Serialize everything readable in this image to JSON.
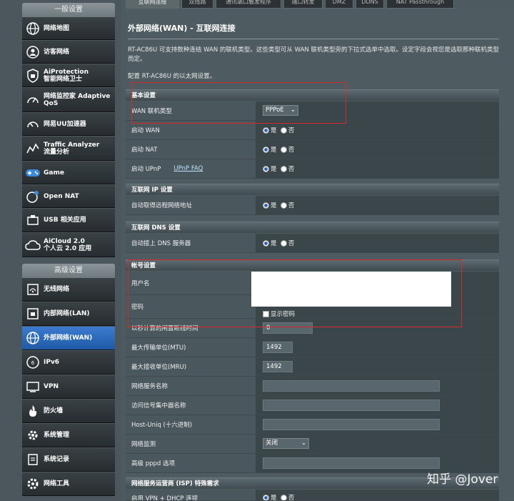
{
  "sidebar": {
    "general_header": "一般设置",
    "advanced_header": "高级设置",
    "general_items": [
      {
        "label": "网络地图",
        "icon": "globe-icon"
      },
      {
        "label": "访客网络",
        "icon": "guest-network-icon"
      },
      {
        "label": "AiProtection\n智能网络卫士",
        "icon": "shield-icon"
      },
      {
        "label": "网络监控家 Adaptive\nQoS",
        "icon": "qos-gauge-icon"
      },
      {
        "label": "网易UU加速器",
        "icon": "speedometer-icon"
      },
      {
        "label": "Traffic Analyzer\n流量分析",
        "icon": "traffic-chart-icon"
      },
      {
        "label": "Game",
        "icon": "gamepad-icon"
      },
      {
        "label": "Open NAT",
        "icon": "open-nat-icon"
      },
      {
        "label": "USB 相关应用",
        "icon": "usb-icon"
      },
      {
        "label": "AiCloud 2.0\n个人云 2.0 应用",
        "icon": "cloud-icon"
      }
    ],
    "advanced_items": [
      {
        "label": "无线网络",
        "icon": "wireless-icon"
      },
      {
        "label": "内部网络(LAN)",
        "icon": "lan-icon"
      },
      {
        "label": "外部网络(WAN)",
        "icon": "wan-globe-icon",
        "active": true
      },
      {
        "label": "IPv6",
        "icon": "ipv6-icon"
      },
      {
        "label": "VPN",
        "icon": "vpn-icon"
      },
      {
        "label": "防火墙",
        "icon": "firewall-icon"
      },
      {
        "label": "系统管理",
        "icon": "admin-gear-icon"
      },
      {
        "label": "系统记录",
        "icon": "log-icon"
      },
      {
        "label": "网络工具",
        "icon": "tools-icon"
      }
    ]
  },
  "tabs": [
    {
      "label": "互联网连接",
      "active": true
    },
    {
      "label": "双线路"
    },
    {
      "label": "通讯端口触发程序"
    },
    {
      "label": "端口转发"
    },
    {
      "label": "DMZ"
    },
    {
      "label": "DDNS"
    },
    {
      "label": "NAT Passthrough"
    }
  ],
  "page": {
    "title": "外部网络(WAN) - 互联网连接",
    "description": "RT-AC86U 可支持数种连结 WAN 的联机类型。这些类型可从 WAN 联机类型旁的下拉式选单中选取。设定字段会视您是选取那种联机类型而定。",
    "config_text": "配置 RT-AC86U 的以太网设置。"
  },
  "radio_labels": {
    "yes": "是",
    "no": "否"
  },
  "sections": {
    "basic": {
      "title": "基本设置",
      "wan_type_label": "WAN 联机类型",
      "wan_type_value": "PPPoE",
      "enable_wan_label": "启动 WAN",
      "enable_nat_label": "启动 NAT",
      "enable_upnp_label": "启动 UPnP",
      "upnp_faq_link": "UPnP  FAQ"
    },
    "ip": {
      "title": "互联网 IP 设置",
      "auto_ip_label": "自动取得远程网络地址"
    },
    "dns": {
      "title": "互联网 DNS 设置",
      "auto_dns_label": "自动接上 DNS 服务器"
    },
    "account": {
      "title": "帐号设置",
      "username_label": "用户名",
      "password_label": "密码",
      "show_password_label": "显示密码",
      "idle_label": "以秒计算的闲置断线时间",
      "idle_value": "0",
      "mtu_label": "最大传输单位(MTU)",
      "mtu_value": "1492",
      "mru_label": "最大接收单位(MRU)",
      "mru_value": "1492",
      "service_name_label": "网络服务名称",
      "ac_name_label": "访问信号集中器名称",
      "host_uniq_label": "Host-Uniq (十六进制)",
      "monitor_label": "网络监测",
      "monitor_value": "关闭",
      "pppd_label": "高级 pppd 选项"
    },
    "isp": {
      "title": "网络服务运营商 (ISP) 特殊需求",
      "vpn_dhcp_label": "启用 VPN + DHCP 连接"
    }
  },
  "watermark": "知乎 @Jover"
}
